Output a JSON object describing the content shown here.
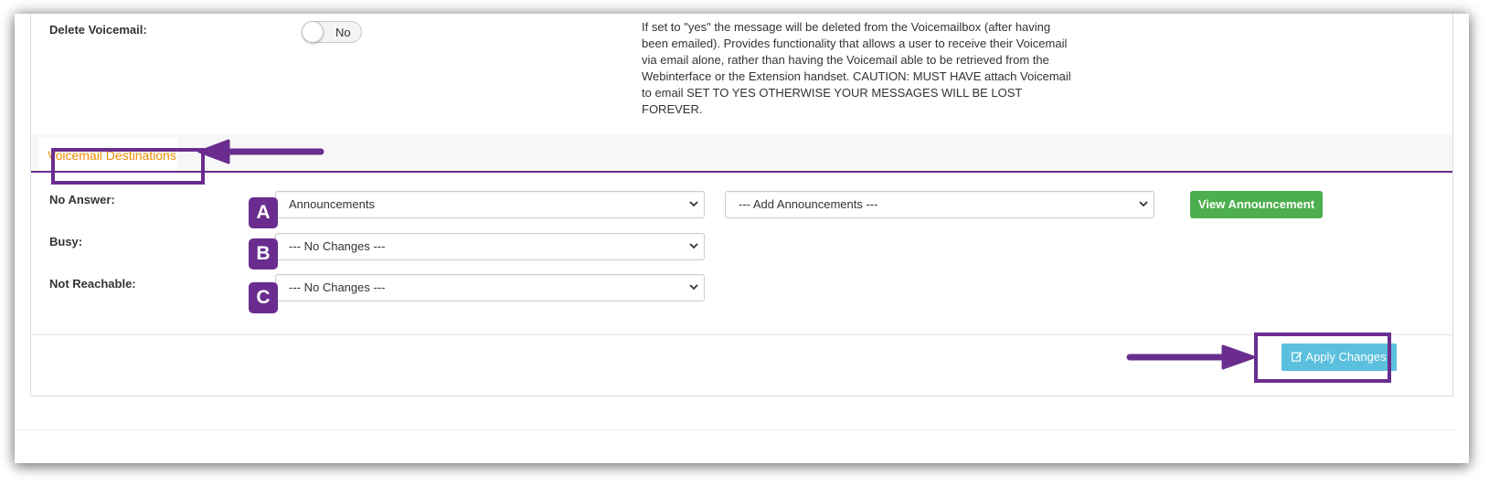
{
  "delete_voicemail": {
    "label": "Delete Voicemail:",
    "toggle_value": "No",
    "help_lines": [
      "If set to \"yes\" the message will be deleted from the Voicemailbox (after having",
      "been emailed). Provides functionality that allows a user to receive their Voicemail",
      "via email alone, rather than having the Voicemail able to be retrieved from the",
      "Webinterface or the Extension handset. CAUTION: MUST HAVE attach Voicemail",
      "to email SET TO YES OTHERWISE YOUR MESSAGES WILL BE LOST FOREVER."
    ]
  },
  "tabs": {
    "active_label": "Voicemail Destinations"
  },
  "destinations": {
    "no_answer": {
      "label": "No Answer:",
      "badge": "A",
      "select_value": "Announcements",
      "secondary_select_value": "--- Add Announcements ---",
      "view_button": "View Announcement"
    },
    "busy": {
      "label": "Busy:",
      "badge": "B",
      "select_value": "--- No Changes ---"
    },
    "not_reachable": {
      "label": "Not Reachable:",
      "badge": "C",
      "select_value": "--- No Changes ---"
    }
  },
  "footer": {
    "apply_label": "Apply Changes",
    "apply_icon": "edit-icon"
  },
  "colors": {
    "annotation_purple": "#6a2d8f",
    "tab_text_orange": "#f08c00",
    "success_green": "#4cae4c",
    "info_blue": "#5bc0de"
  }
}
